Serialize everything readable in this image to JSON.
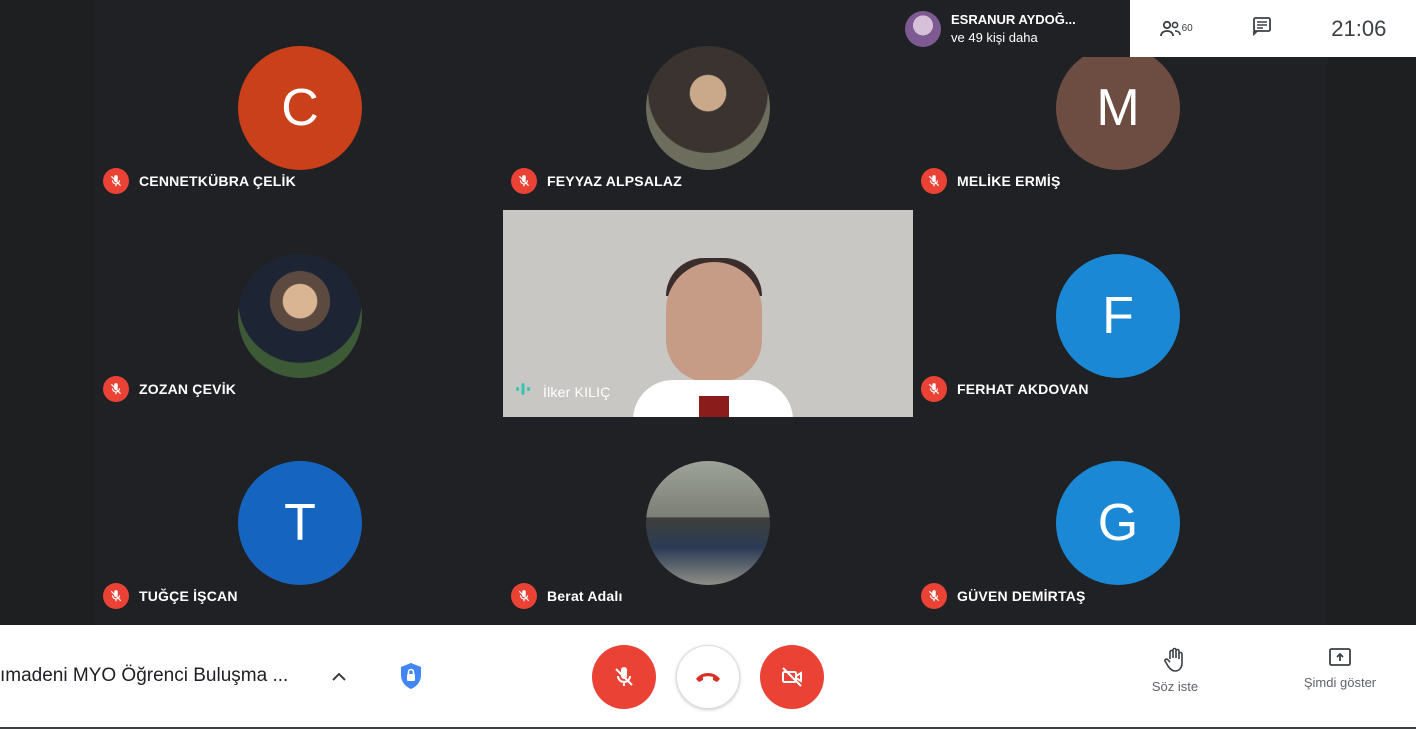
{
  "participants": [
    {
      "name": "CENNETKÜBRA ÇELİK",
      "initial": "C",
      "color": "#c9401a"
    },
    {
      "name": "FEYYAZ ALPSALAZ",
      "initial": "",
      "color": ""
    },
    {
      "name": "MELİKE ERMİŞ",
      "initial": "M",
      "color": "#6d4c41"
    },
    {
      "name": "ZOZAN ÇEVİK",
      "initial": "",
      "color": ""
    },
    {
      "name": "İlker KILIÇ",
      "initial": "",
      "color": ""
    },
    {
      "name": "FERHAT AKDOVAN",
      "initial": "F",
      "color": "#1a88d4"
    },
    {
      "name": "TUĞÇE İŞCAN",
      "initial": "T",
      "color": "#1565c0"
    },
    {
      "name": "Berat Adalı",
      "initial": "",
      "color": ""
    },
    {
      "name": "GÜVEN DEMİRTAŞ",
      "initial": "G",
      "color": "#1a88d4"
    }
  ],
  "top_badge": {
    "line1": "ESRANUR AYDOĞ...",
    "line2": "ve 49 kişi daha"
  },
  "top_bar": {
    "participant_count": "60",
    "clock": "21:06"
  },
  "bottom": {
    "meeting_title": "ımadeni MYO Öğrenci Buluşma ...",
    "raise_hand_label": "Söz iste",
    "present_label": "Şimdi göster"
  },
  "colors": {
    "mute_red": "#ea4335",
    "stage_bg": "#202124",
    "speaking_teal": "#34c6b3"
  }
}
